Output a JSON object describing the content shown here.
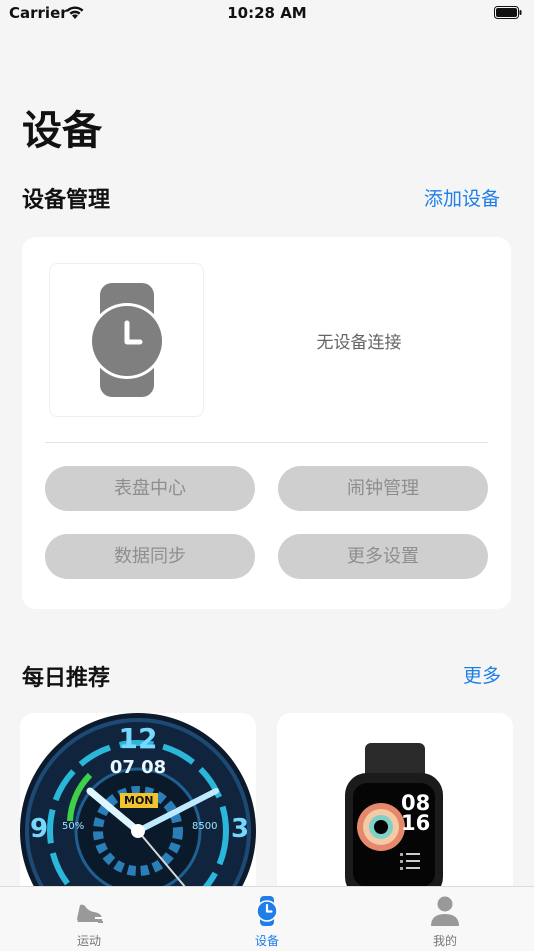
{
  "status_bar": {
    "carrier": "Carrier",
    "time": "10:28 AM"
  },
  "header": {
    "title": "设备"
  },
  "device_management": {
    "title": "设备管理",
    "add_link": "添加设备",
    "status_text": "无设备连接",
    "buttons": [
      "表盘中心",
      "闹钟管理",
      "数据同步",
      "更多设置"
    ]
  },
  "daily_recommend": {
    "title": "每日推荐",
    "more_link": "更多",
    "items": [
      {
        "face_hour": "12",
        "face_time": "07 08",
        "face_day": "MON",
        "face_numbers": [
          "9",
          "3"
        ],
        "face_stats": [
          "50%",
          "8500"
        ]
      },
      {
        "face_time": [
          "08",
          "16"
        ]
      }
    ]
  },
  "tab_bar": {
    "tabs": [
      {
        "label": "运动",
        "icon": "running-shoe-icon"
      },
      {
        "label": "设备",
        "icon": "watch-icon",
        "active": true
      },
      {
        "label": "我的",
        "icon": "person-icon"
      }
    ]
  },
  "colors": {
    "accent": "#1f7ee8",
    "card": "#ffffff",
    "background": "#f5f5f6",
    "disabled_button": "#cfcfcf"
  }
}
